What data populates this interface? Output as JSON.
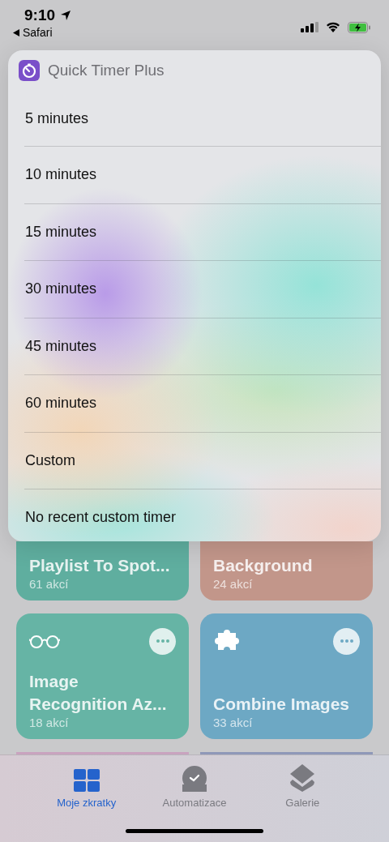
{
  "status_bar": {
    "time": "9:10",
    "back_label": "Safari"
  },
  "menu": {
    "title": "Quick Timer Plus",
    "items": [
      {
        "label": "5 minutes"
      },
      {
        "label": "10 minutes"
      },
      {
        "label": "15 minutes"
      },
      {
        "label": "30 minutes"
      },
      {
        "label": "45 minutes"
      },
      {
        "label": "60 minutes"
      },
      {
        "label": "Custom"
      },
      {
        "label": "No recent custom timer"
      }
    ]
  },
  "shortcuts": [
    {
      "title": "Playlist To Spot...",
      "count": "61 akcí",
      "color": "#5fae9f",
      "kind": "partial"
    },
    {
      "title": "Background",
      "count": "24 akcí",
      "color": "#c2968a",
      "kind": "partial"
    },
    {
      "title": "Image Recognition Az...",
      "count": "18 akcí",
      "color": "#66b4a5",
      "kind": "glasses"
    },
    {
      "title": "Combine Images",
      "count": "33 akcí",
      "color": "#6da8c4",
      "kind": "puzzle"
    },
    {
      "color": "#c9a3bf",
      "kind": "edge"
    },
    {
      "color": "#8f98b8",
      "kind": "edge"
    }
  ],
  "tab_bar": [
    {
      "label": "Moje zkratky",
      "selected": true,
      "kind": "grid"
    },
    {
      "label": "Automatizace",
      "selected": false,
      "kind": "clock"
    },
    {
      "label": "Galerie",
      "selected": false,
      "kind": "layers"
    }
  ]
}
